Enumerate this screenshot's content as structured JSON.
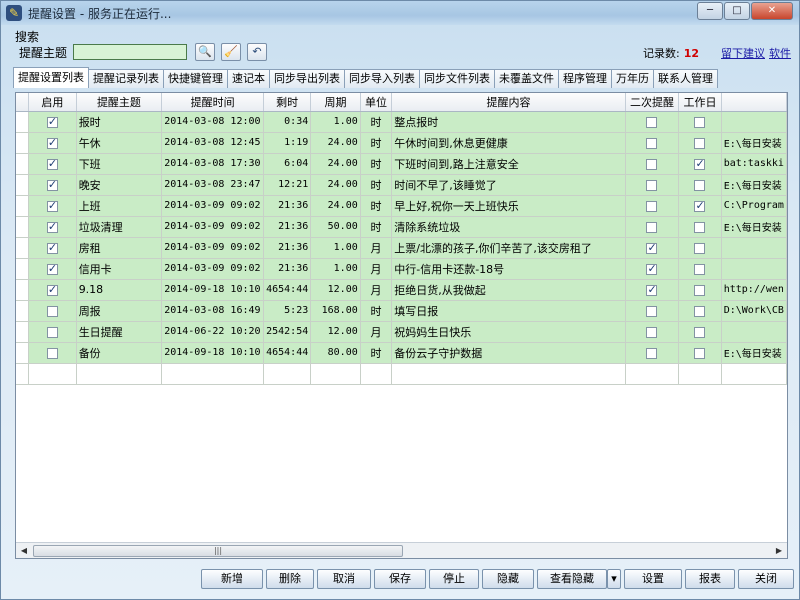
{
  "window": {
    "title": "提醒设置 - 服务正在运行..."
  },
  "search": {
    "section_label": "搜索",
    "topic_label": "提醒主题",
    "topic_value": "",
    "record_count_label": "记录数:",
    "record_count_value": "12",
    "suggest_link": "留下建议",
    "soft_link": "软件"
  },
  "tabs": [
    {
      "label": "提醒设置列表",
      "active": true
    },
    {
      "label": "提醒记录列表"
    },
    {
      "label": "快捷键管理"
    },
    {
      "label": "速记本"
    },
    {
      "label": "同步导出列表"
    },
    {
      "label": "同步导入列表"
    },
    {
      "label": "同步文件列表"
    },
    {
      "label": "未覆盖文件"
    },
    {
      "label": "程序管理"
    },
    {
      "label": "万年历"
    },
    {
      "label": "联系人管理"
    }
  ],
  "table": {
    "headers": [
      "启用",
      "提醒主题",
      "提醒时间",
      "剩时",
      "周期",
      "单位",
      "提醒内容",
      "二次提醒",
      "工作日",
      ""
    ],
    "rows": [
      {
        "enabled": true,
        "topic": "报时",
        "time": "2014-03-08 12:00",
        "remain": "0:34",
        "period": "1.00",
        "unit": "时",
        "content": "整点报时",
        "second": false,
        "workday": false,
        "extra": ""
      },
      {
        "enabled": true,
        "topic": "午休",
        "time": "2014-03-08 12:45",
        "remain": "1:19",
        "period": "24.00",
        "unit": "时",
        "content": "午休时间到,休息更健康",
        "second": false,
        "workday": false,
        "extra": "E:\\每日安装"
      },
      {
        "enabled": true,
        "topic": "下班",
        "time": "2014-03-08 17:30",
        "remain": "6:04",
        "period": "24.00",
        "unit": "时",
        "content": "下班时间到,路上注意安全",
        "second": false,
        "workday": true,
        "extra": "bat:taskki"
      },
      {
        "enabled": true,
        "topic": "晚安",
        "time": "2014-03-08 23:47",
        "remain": "12:21",
        "period": "24.00",
        "unit": "时",
        "content": "时间不早了,该睡觉了",
        "second": false,
        "workday": false,
        "extra": "E:\\每日安装"
      },
      {
        "enabled": true,
        "topic": "上班",
        "time": "2014-03-09 09:02",
        "remain": "21:36",
        "period": "24.00",
        "unit": "时",
        "content": "早上好,祝你一天上班快乐",
        "second": false,
        "workday": true,
        "extra": "C:\\Program"
      },
      {
        "enabled": true,
        "topic": "垃圾清理",
        "time": "2014-03-09 09:02",
        "remain": "21:36",
        "period": "50.00",
        "unit": "时",
        "content": "清除系统垃圾",
        "second": false,
        "workday": false,
        "extra": "E:\\每日安装"
      },
      {
        "enabled": true,
        "topic": "房租",
        "time": "2014-03-09 09:02",
        "remain": "21:36",
        "period": "1.00",
        "unit": "月",
        "content": "上票/北漂的孩子,你们辛苦了,该交房租了",
        "second": true,
        "workday": false,
        "extra": ""
      },
      {
        "enabled": true,
        "topic": "信用卡",
        "time": "2014-03-09 09:02",
        "remain": "21:36",
        "period": "1.00",
        "unit": "月",
        "content": "中行-信用卡还款-18号",
        "second": true,
        "workday": false,
        "extra": ""
      },
      {
        "enabled": true,
        "topic": "9.18",
        "time": "2014-09-18 10:10",
        "remain": "4654:44",
        "period": "12.00",
        "unit": "月",
        "content": "拒绝日货,从我做起",
        "second": true,
        "workday": false,
        "extra": "http://wen"
      },
      {
        "enabled": false,
        "topic": "周报",
        "time": "2014-03-08 16:49",
        "remain": "5:23",
        "period": "168.00",
        "unit": "时",
        "content": "填写日报",
        "second": false,
        "workday": false,
        "extra": "D:\\Work\\CB"
      },
      {
        "enabled": false,
        "topic": "生日提醒",
        "time": "2014-06-22 10:20",
        "remain": "2542:54",
        "period": "12.00",
        "unit": "月",
        "content": "祝妈妈生日快乐",
        "second": false,
        "workday": false,
        "extra": ""
      },
      {
        "enabled": false,
        "topic": "备份",
        "time": "2014-09-18 10:10",
        "remain": "4654:44",
        "period": "80.00",
        "unit": "时",
        "content": "备份云子守护数据",
        "second": false,
        "workday": false,
        "extra": "E:\\每日安装"
      }
    ]
  },
  "buttons": {
    "add": "新增",
    "delete": "删除",
    "cancel": "取消",
    "save": "保存",
    "stop": "停止",
    "hide": "隐藏",
    "view_hidden": "查看隐藏",
    "settings": "设置",
    "report": "报表",
    "close": "关闭"
  }
}
